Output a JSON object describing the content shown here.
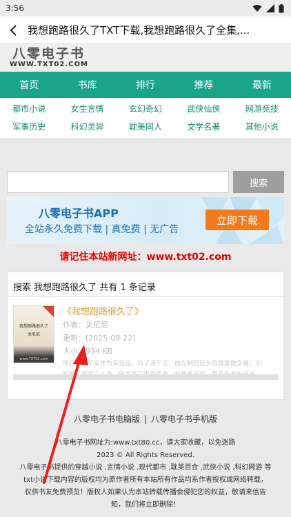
{
  "status": {
    "time": "3:56"
  },
  "titlebar": {
    "title": "我想跑路很久了TXT下载,我想跑路很久了全集,..."
  },
  "logo": {
    "cn": "八零电子书",
    "en": "WWW.TXT02.COM"
  },
  "nav": [
    "首页",
    "书库",
    "排行",
    "推荐",
    "最新"
  ],
  "categories": [
    "都市小说",
    "女生言情",
    "玄幻奇幻",
    "武侠仙侠",
    "网游竞技",
    "军事历史",
    "科幻灵异",
    "耽美同人",
    "文学名著",
    "其他小说"
  ],
  "search": {
    "button": "搜索",
    "placeholder": ""
  },
  "banner": {
    "title": "八零电子书APP",
    "subtitle": "全站永久免费下载 | 真免费 | 无广告",
    "button": "立即下载"
  },
  "notice": "请记住本站新网址：www.txt02.com",
  "results": {
    "header": "搜索 我想跑路很久了 共有 1 条记录",
    "book": {
      "title": "《我想跑路很久了》",
      "author": "作者：关尼尼",
      "updated": "更新：[2025-09-22]",
      "size": "大小：934 KB",
      "desc1": "简介：为了安作为实验品，为了活下去，他与制药巨头的莫家做交易，交易内",
      "desc2": "容是：莫家二少爷。席主莫广出身优渥，却意冬无常，甚至有着极度厌",
      "cover_text": "我想跑路很久了",
      "cover_author": "关尼尼",
      "cover_foot": "www.TXT02.com"
    }
  },
  "footer": {
    "links": [
      "八零电子书电脑版",
      "八零电子书手机版"
    ],
    "line1": "八零电子书网址为:www.txt80.cc，请大家收藏，以免迷路",
    "line2": "2023 © All Rights Reserved.",
    "line3": "八零电子书提供的穿越小说 ,言情小说 ,现代都市 ,耽美百合 ,武侠小说 ,科幻网游 等",
    "line4": "txt小说下载内容的版权均为原作者所有本站所有作品均系作者授权或网络转载，",
    "line5": "仅供书友免费预览！版权人如果认为本站转载传播会侵犯您的权益，敬请来信告",
    "line6": "知，我们将立即删除！"
  },
  "colors": {
    "nav": "#1aa58a",
    "category": "#0e8a72",
    "notice": "#e60000",
    "book_title": "#e29a2a",
    "banner_button": "#f07a1c",
    "annotation_arrow": "#e8201e"
  }
}
